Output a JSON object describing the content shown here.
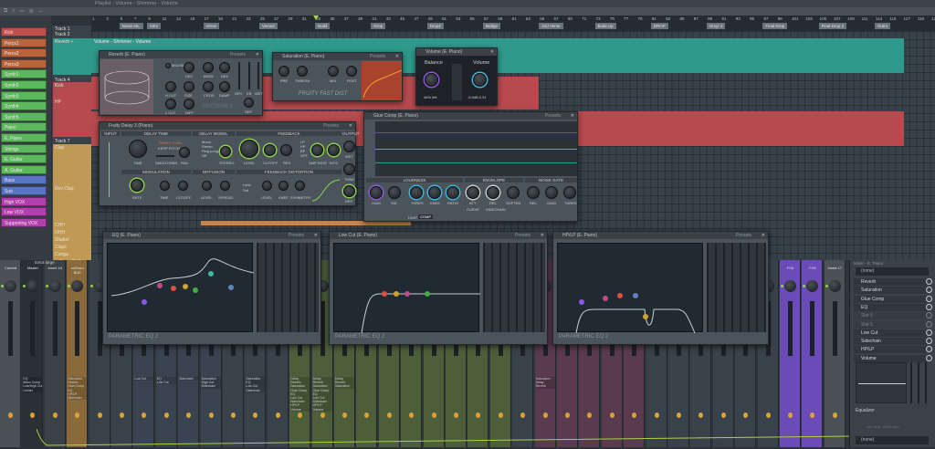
{
  "window": {
    "title": "Playlist - Volume - Shimmer - Volume"
  },
  "toolbar": {
    "icons": [
      "snap-icon",
      "zoom-icon",
      "cut-icon",
      "mute-icon",
      "slip-icon"
    ]
  },
  "channels": [
    {
      "label": "Kick",
      "color": "#c0504d"
    },
    {
      "label": "Percs1",
      "color": "#b8653e"
    },
    {
      "label": "Percs2",
      "color": "#b8653e"
    },
    {
      "label": "Percs3",
      "color": "#b8653e"
    },
    {
      "label": "Synth1",
      "color": "#5cb85c"
    },
    {
      "label": "Synth2",
      "color": "#5cb85c"
    },
    {
      "label": "Synth3",
      "color": "#5cb85c"
    },
    {
      "label": "Synth4",
      "color": "#5cb85c"
    },
    {
      "label": "Synth5",
      "color": "#5cb85c"
    },
    {
      "label": "Piano",
      "color": "#5cb85c"
    },
    {
      "label": "E. Piano",
      "color": "#5cb85c"
    },
    {
      "label": "Strings",
      "color": "#5cb85c"
    },
    {
      "label": "E. Guitar",
      "color": "#5cb85c"
    },
    {
      "label": "A. Guitar",
      "color": "#5cb85c"
    },
    {
      "label": "Bass",
      "color": "#5a74c4"
    },
    {
      "label": "Sub",
      "color": "#5a74c4"
    },
    {
      "label": "High VOX",
      "color": "#b23fae"
    },
    {
      "label": "Low VOX",
      "color": "#b23fae"
    },
    {
      "label": "Supporting VOX",
      "color": "#b23fae"
    }
  ],
  "tracks": [
    "Track 1",
    "Track 2",
    "Reverb +",
    "Track 4",
    "Kick",
    "HP",
    "Track 7",
    "Clap",
    "Rev Clap",
    "CHH",
    "OHH",
    "Shaker",
    "Claps",
    "Conga",
    "xxDrum BUS"
  ],
  "ruler": {
    "bars": [
      1,
      3,
      5,
      7,
      9,
      11,
      13,
      15,
      17,
      19,
      21,
      23,
      25,
      27,
      29,
      31,
      33,
      35,
      37,
      39,
      41,
      43,
      45,
      47,
      49,
      51,
      53,
      55,
      57,
      59,
      61,
      63,
      65,
      67,
      69,
      71,
      73,
      75,
      77,
      79,
      81,
      83,
      85,
      87,
      89,
      91,
      93,
      95,
      97,
      99,
      101,
      103,
      105,
      107,
      109,
      111,
      113,
      115,
      117,
      119,
      121
    ],
    "markers": [
      {
        "bar": 5,
        "label": "Noise etc."
      },
      {
        "bar": 9,
        "label": "Intro"
      },
      {
        "bar": 17,
        "label": "Verse"
      },
      {
        "bar": 25,
        "label": "Verse2"
      },
      {
        "bar": 33,
        "label": "Build"
      },
      {
        "bar": 41,
        "label": "Drop"
      },
      {
        "bar": 49,
        "label": "Drop2"
      },
      {
        "bar": 57,
        "label": "Bridge"
      },
      {
        "bar": 65,
        "label": "2nd Verse"
      },
      {
        "bar": 73,
        "label": "Build Up"
      },
      {
        "bar": 81,
        "label": "DROP"
      },
      {
        "bar": 89,
        "label": "Drop' 2"
      },
      {
        "bar": 97,
        "label": "Final Drop"
      },
      {
        "bar": 105,
        "label": "Final Drop 2"
      },
      {
        "bar": 113,
        "label": "Outro"
      }
    ]
  },
  "clips": {
    "automation": "Volume - Shimmer - Volume"
  },
  "plugins": {
    "reverb": {
      "title": "Reverb (E. Piano)",
      "presets": "Presets",
      "brand": "REEVERB 2",
      "knobs": [
        "MID/SIDE",
        "DEC",
        "BASS",
        "DEC",
        "H.CUT",
        "SIZE",
        "CROS",
        "DAMP",
        "L.CUT",
        "DIFF",
        "DRY",
        "ER",
        "WET",
        "SEP"
      ]
    },
    "saturation": {
      "title": "Saturation (E. Piano)",
      "presets": "Presets",
      "brand": "FRUITY FAST DIST",
      "knobs": [
        "PRE",
        "THRESH",
        "MIX",
        "POST"
      ]
    },
    "volume": {
      "title": "Volume (E. Piano)",
      "balance": "Balance",
      "volume": "Volume",
      "balance_val": "46% left",
      "volume_val": "-5.9dB 0.51"
    },
    "delay": {
      "title": "Fruity Delay 3 (Piano)",
      "presets": "Presets",
      "sections": [
        "INPUT",
        "DELAY TIME",
        "DELAY MODEL",
        "FEEDBACK",
        "OUTPUT",
        "MODULATION",
        "DIFFUSION",
        "FEEDBACK DISTORTION"
      ],
      "modes": [
        "Mono",
        "Stereo",
        "Ping pong",
        "Off"
      ],
      "filters": [
        "LP",
        "HP",
        "BP",
        "OFF"
      ],
      "options": [
        "TEMPO SYNC",
        "KEEP PITCH"
      ],
      "knobs": [
        "TIME",
        "SMOOTHING",
        "PAN",
        "STEREO",
        "LEVEL",
        "CUTOFF",
        "RES",
        "SMP RATE",
        "BITS",
        "WET",
        "TONE",
        "DRY",
        "RATE",
        "TIME",
        "CUTOFF",
        "LEVEL",
        "SPREAD",
        "LEVEL",
        "KNEE",
        "SYMMETRY"
      ],
      "dist_modes": [
        "Limit",
        "Sat"
      ]
    },
    "glue": {
      "title": "Glue Comp (E. Piano)",
      "presets": "Presets",
      "sections": [
        "LOUDNESS",
        "ENVELOPE",
        "NOISE GATE"
      ],
      "knobs": [
        "GAIN",
        "SID",
        "THRES",
        "KNEE",
        "RATIO",
        "ATT",
        "REL",
        "SOFTEN",
        "REL",
        "GAIN",
        "THRES"
      ],
      "curve": "CURVE",
      "sidechain": "SIDECHAIN",
      "limit": "LIMIT",
      "comp": "COMP"
    },
    "eq": {
      "title": "EQ (E. Piano)",
      "brand": "PARAMETRIC EQ 2",
      "presets": "Presets"
    },
    "lowcut": {
      "title": "Low Cut (E. Piano)",
      "brand": "PARAMETRIC EQ 2",
      "presets": "Presets"
    },
    "hplp": {
      "title": "HP/LP (E. Piano)",
      "brand": "PARAMETRIC EQ 2",
      "presets": "Presets"
    }
  },
  "mixer": {
    "header": "Extra large",
    "strips": [
      {
        "name": "Current",
        "color": "#4a5258"
      },
      {
        "name": "Master",
        "color": "#2a3034",
        "fx": [
          "EQ",
          "Maxx Comp",
          "Low/High Cut",
          "Limiter"
        ]
      },
      {
        "name": "Insert 16",
        "color": "#3a4147"
      },
      {
        "name": "xxDrum BUS",
        "color": "#8a6a3a",
        "fx": [
          "Saturation",
          "Reverb",
          "Glue Comp",
          "EQ",
          "HP/LP",
          "Sidechain"
        ]
      },
      {
        "name": "",
        "color": "#39424a"
      },
      {
        "name": "",
        "color": "#39424a"
      },
      {
        "name": "",
        "color": "#3a4450",
        "fx": [
          "Low Cut"
        ]
      },
      {
        "name": "",
        "color": "#3a4450",
        "fx": [
          "EQ",
          "Low Cut"
        ]
      },
      {
        "name": "",
        "color": "#3a4450",
        "fx": [
          "Sidechain"
        ]
      },
      {
        "name": "",
        "color": "#3a4450",
        "fx": [
          "Saturation",
          "High Cut",
          "Sidechain"
        ]
      },
      {
        "name": "",
        "color": "#39424a"
      },
      {
        "name": "",
        "color": "#39424a",
        "fx": [
          "Saturation",
          "EQ",
          "Low Cut",
          "Sidechain"
        ]
      },
      {
        "name": "",
        "color": "#39424a"
      },
      {
        "name": "",
        "color": "#4c5e3a",
        "fx": [
          "Delay",
          "Reverb",
          "Saturation",
          "Glue Comp",
          "EQ",
          "Low Cut",
          "Sidechain",
          "HP/LP",
          "Volume"
        ]
      },
      {
        "name": "",
        "color": "#4c5e3a",
        "fx": [
          "Delay",
          "Reverb",
          "Saturation",
          "Glue Comp",
          "EQ",
          "Low Cut",
          "Sidechain",
          "HP/LP",
          "Volume"
        ]
      },
      {
        "name": "",
        "color": "#4c5e3a",
        "fx": [
          "Delay",
          "Reverb",
          "Saturation"
        ]
      },
      {
        "name": "",
        "color": "#4c5e3a"
      },
      {
        "name": "",
        "color": "#4c5e3a"
      },
      {
        "name": "",
        "color": "#4c5e3a"
      },
      {
        "name": "",
        "color": "#4c5e3a"
      },
      {
        "name": "",
        "color": "#4c5e3a"
      },
      {
        "name": "",
        "color": "#4c5e3a"
      },
      {
        "name": "",
        "color": "#4c5e3a"
      },
      {
        "name": "",
        "color": "#39424a"
      },
      {
        "name": "",
        "color": "#5a3a4e",
        "fx": [
          "Saturation",
          "Delay",
          "Reverb"
        ]
      },
      {
        "name": "",
        "color": "#5a3a4e"
      },
      {
        "name": "",
        "color": "#5a3a4e"
      },
      {
        "name": "",
        "color": "#5a3a4e"
      },
      {
        "name": "",
        "color": "#5a3a4e"
      },
      {
        "name": "",
        "color": "#39424a"
      },
      {
        "name": "",
        "color": "#39424a"
      },
      {
        "name": "",
        "color": "#39424a"
      },
      {
        "name": "",
        "color": "#39424a"
      },
      {
        "name": "",
        "color": "#39424a"
      },
      {
        "name": "",
        "color": "#39424a"
      },
      {
        "name": "FX6",
        "color": "#6a4bb8"
      },
      {
        "name": "FX5",
        "color": "#6a4bb8"
      },
      {
        "name": "Insert 17",
        "color": "#4a5258"
      }
    ]
  },
  "rpanel": {
    "title": "Mixer - E. Piano",
    "input": "(none)",
    "output": "(none)",
    "slots": [
      {
        "name": "Reverb",
        "on": true
      },
      {
        "name": "Saturation",
        "on": true
      },
      {
        "name": "Glue Comp",
        "on": true
      },
      {
        "name": "EQ",
        "on": true
      },
      {
        "name": "Slot 5",
        "on": false
      },
      {
        "name": "Slot 6",
        "on": false
      },
      {
        "name": "Low Cut",
        "on": true
      },
      {
        "name": "Sidechain",
        "on": true
      },
      {
        "name": "HP/LP",
        "on": true
      },
      {
        "name": "Volume",
        "on": true
      }
    ],
    "eq_label": "Equalizer",
    "latency": "44.1kHz / 2048 smp"
  }
}
